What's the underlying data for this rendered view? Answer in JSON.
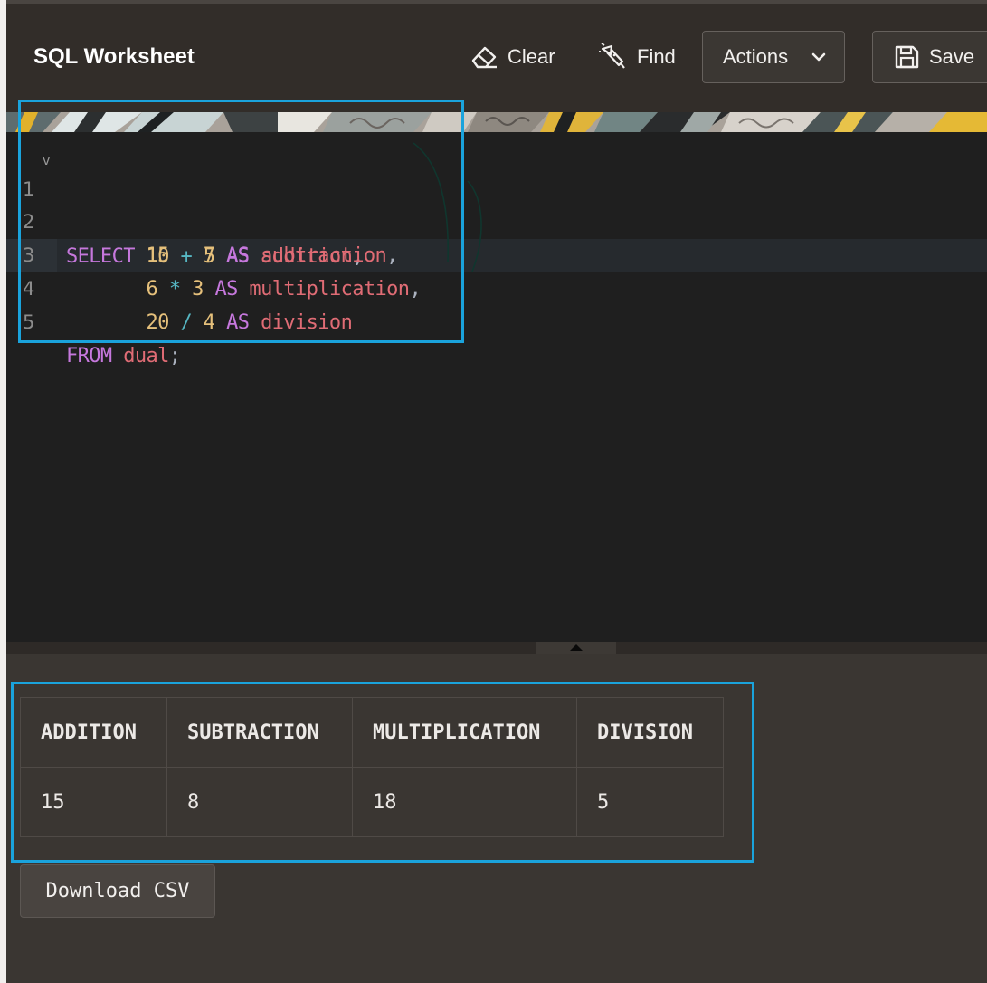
{
  "header": {
    "title": "SQL Worksheet",
    "clear_label": "Clear",
    "find_label": "Find",
    "actions_label": "Actions",
    "save_label": "Save"
  },
  "icons": {
    "clear": "eraser-icon",
    "find": "flashlight-icon",
    "actions": "chevron-down-icon",
    "save": "floppy-disk-icon"
  },
  "editor": {
    "lines": [
      {
        "number": "1",
        "tokens": [
          "SELECT",
          "10",
          "+",
          "5",
          "AS",
          "addition",
          ","
        ]
      },
      {
        "number": "2",
        "tokens": [
          "15",
          "-",
          "7",
          "AS",
          "subtraction",
          ","
        ]
      },
      {
        "number": "3",
        "tokens": [
          "6",
          "*",
          "3",
          "AS",
          "multiplication",
          ","
        ]
      },
      {
        "number": "4",
        "tokens": [
          "20",
          "/",
          "4",
          "AS",
          "division"
        ]
      },
      {
        "number": "5",
        "tokens": [
          "FROM",
          "dual",
          ";"
        ]
      }
    ],
    "active_line": 4,
    "fold_marker": "v"
  },
  "results": {
    "columns": [
      "ADDITION",
      "SUBTRACTION",
      "MULTIPLICATION",
      "DIVISION"
    ],
    "rows": [
      [
        "15",
        "8",
        "18",
        "5"
      ]
    ]
  },
  "download_label": "Download CSV",
  "colors": {
    "keyword": "#c678dd",
    "number": "#e5c07b",
    "operator": "#56b6c2",
    "identifier": "#e06c75",
    "highlight_box": "#1aa3dc"
  }
}
